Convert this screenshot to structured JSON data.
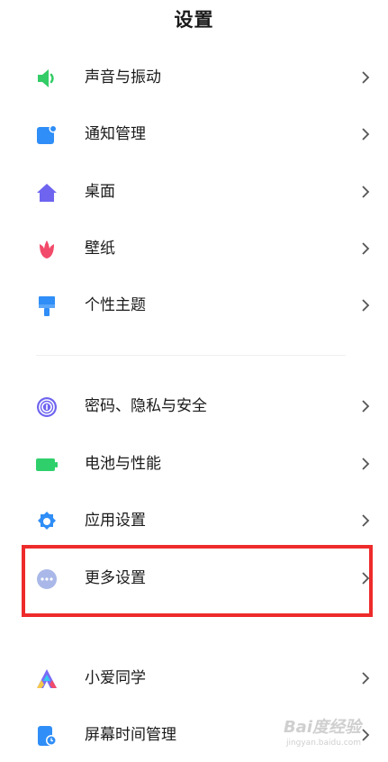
{
  "header": {
    "title": "设置"
  },
  "group1": [
    {
      "label": "声音与振动",
      "icon": "speaker-icon",
      "color": "#33cc66"
    },
    {
      "label": "通知管理",
      "icon": "notification-icon",
      "color": "#2f8ef7"
    },
    {
      "label": "桌面",
      "icon": "home-icon",
      "color": "#6e64f0"
    },
    {
      "label": "壁纸",
      "icon": "flower-icon",
      "color": "#f24a6a"
    },
    {
      "label": "个性主题",
      "icon": "brush-icon",
      "color": "#2f8ef7"
    }
  ],
  "group2": [
    {
      "label": "密码、隐私与安全",
      "icon": "fingerprint-icon",
      "color": "#6e64f0"
    },
    {
      "label": "电池与性能",
      "icon": "battery-icon",
      "color": "#2fd06b"
    },
    {
      "label": "应用设置",
      "icon": "gear-icon",
      "color": "#2f8ef7"
    },
    {
      "label": "更多设置",
      "icon": "more-dots-icon",
      "color": "#a9b8e8"
    }
  ],
  "group3": [
    {
      "label": "小爱同学",
      "icon": "xiaoai-icon",
      "color": "#7a6cf6"
    },
    {
      "label": "屏幕时间管理",
      "icon": "screen-time-icon",
      "color": "#2f8ef7"
    }
  ],
  "highlight_color": "#ee2b2b",
  "watermark": {
    "text": "Bai度经验",
    "subtext": "jingyan.baidu.com"
  }
}
